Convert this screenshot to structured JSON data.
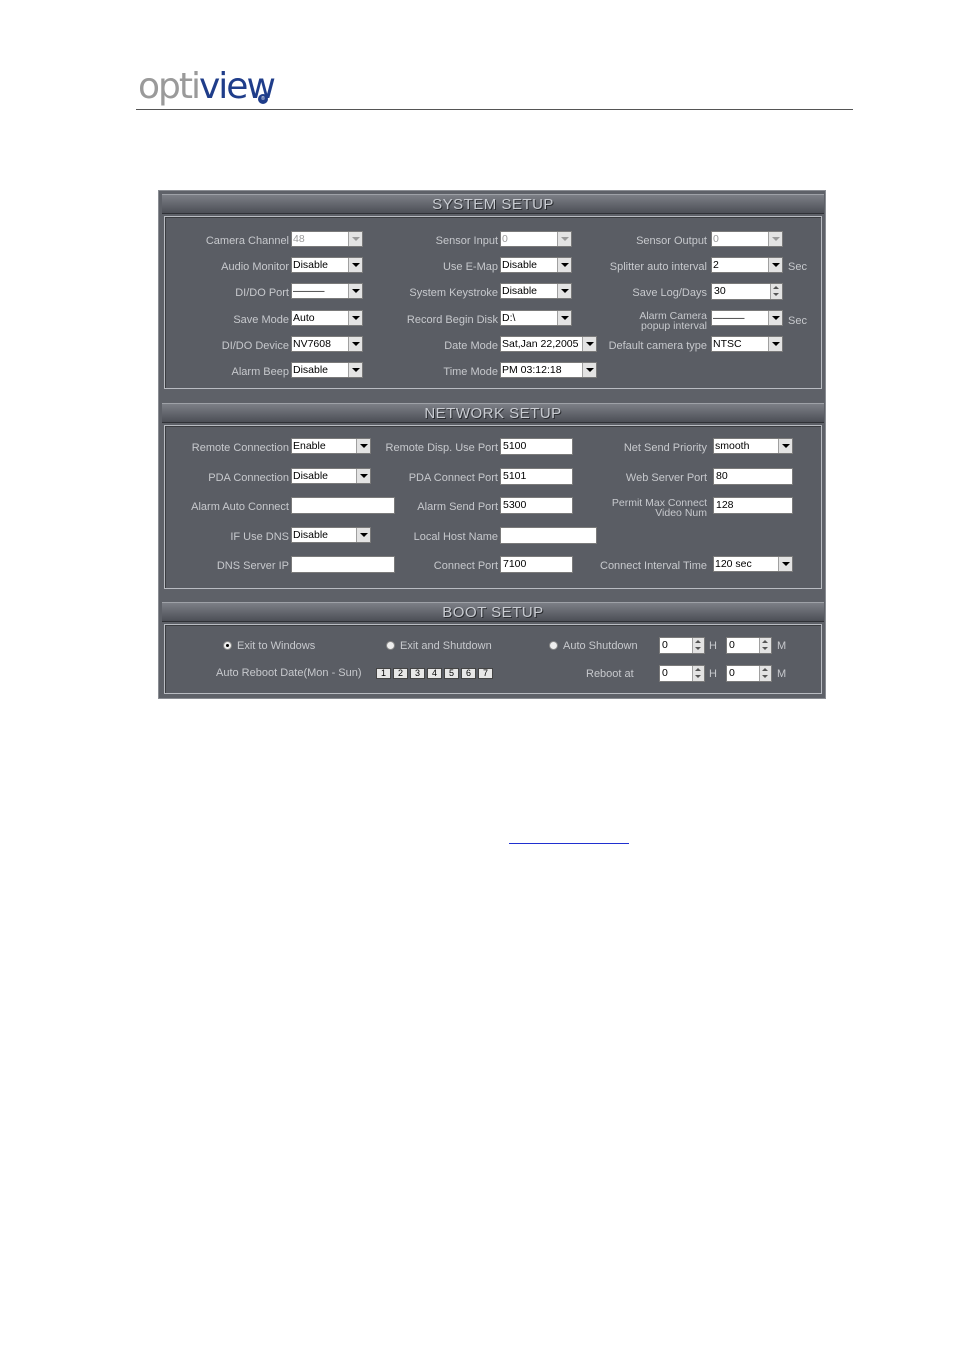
{
  "logo": {
    "text_opti": "opti",
    "text_view": "view",
    "mark": "®"
  },
  "system": {
    "title": "SYSTEM SETUP",
    "col1": [
      {
        "label": "Camera Channel",
        "value": "48",
        "disabled": true
      },
      {
        "label": "Audio Monitor",
        "value": "Disable"
      },
      {
        "label": "DI/DO Port",
        "value": "———"
      },
      {
        "label": "Save Mode",
        "value": "Auto"
      },
      {
        "label": "DI/DO Device",
        "value": "NV7608"
      },
      {
        "label": "Alarm Beep",
        "value": "Disable"
      }
    ],
    "col2": [
      {
        "label": "Sensor Input",
        "value": "0",
        "disabled": true
      },
      {
        "label": "Use E-Map",
        "value": "Disable"
      },
      {
        "label": "System Keystroke",
        "value": "Disable"
      },
      {
        "label": "Record Begin Disk",
        "value": "D:\\"
      },
      {
        "label": "Date Mode",
        "value": "Sat,Jan 22,2005"
      },
      {
        "label": "Time Mode",
        "value": "PM 03:12:18"
      }
    ],
    "col3": [
      {
        "label": "Sensor Output",
        "value": "0",
        "disabled": true
      },
      {
        "label": "Splitter auto interval",
        "value": "2",
        "unit": "Sec"
      },
      {
        "label": "Save Log/Days",
        "value": "30"
      },
      {
        "label": "Alarm Camera popup interval",
        "value": "———",
        "unit": "Sec"
      },
      {
        "label": "Default camera  type",
        "value": "NTSC"
      }
    ]
  },
  "network": {
    "title": "NETWORK SETUP",
    "col1": [
      {
        "label": "Remote Connection",
        "value": "Enable"
      },
      {
        "label": "PDA Connection",
        "value": "Disable"
      },
      {
        "label": "Alarm Auto Connect",
        "value": ""
      },
      {
        "label": "IF Use DNS",
        "value": "Disable"
      },
      {
        "label": "DNS Server IP",
        "value": ""
      }
    ],
    "col2": [
      {
        "label": "Remote Disp. Use Port",
        "value": "5100"
      },
      {
        "label": "PDA Connect Port",
        "value": "5101"
      },
      {
        "label": "Alarm Send Port",
        "value": "5300"
      },
      {
        "label": "Local Host Name",
        "value": ""
      },
      {
        "label": "Connect Port",
        "value": "7100"
      }
    ],
    "col3": [
      {
        "label": "Net Send Priority",
        "value": "smooth"
      },
      {
        "label": "Web Server Port",
        "value": "80"
      },
      {
        "label": "Permit Max Connect Video Num",
        "value": "128"
      },
      {
        "label": "Connect Interval Time",
        "value": "120 sec"
      }
    ]
  },
  "boot": {
    "title": "BOOT SETUP",
    "options": [
      {
        "label": "Exit to Windows",
        "selected": true
      },
      {
        "label": "Exit and Shutdown",
        "selected": false
      },
      {
        "label": "Auto Shutdown",
        "selected": false
      }
    ],
    "auto_shutdown": {
      "h": "0",
      "m": "0",
      "h_unit": "H",
      "m_unit": "M"
    },
    "reboot_days_label": "Auto Reboot Date(Mon - Sun)",
    "days": [
      "1",
      "2",
      "3",
      "4",
      "5",
      "6",
      "7"
    ],
    "reboot_at_label": "Reboot at",
    "reboot_at": {
      "h": "0",
      "m": "0",
      "h_unit": "H",
      "m_unit": "M"
    }
  }
}
